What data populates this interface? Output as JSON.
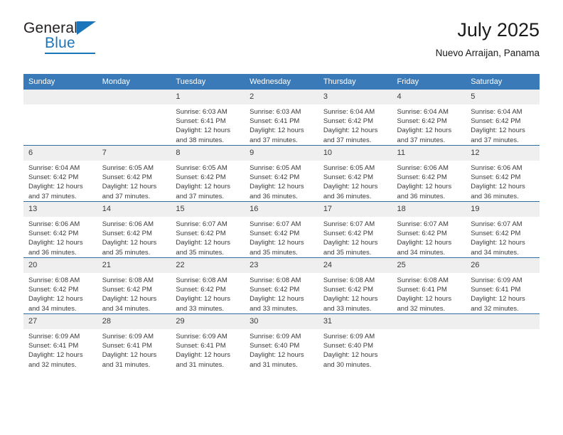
{
  "brand": {
    "name_top": "General",
    "name_bottom": "Blue",
    "accent_color": "#1b75bb"
  },
  "header": {
    "title": "July 2025",
    "subtitle": "Nuevo Arraijan, Panama",
    "header_bg": "#3a7ab8",
    "daynum_bg": "#efefef",
    "row_divider": "#2e6da4"
  },
  "weekday_headers": [
    "Sunday",
    "Monday",
    "Tuesday",
    "Wednesday",
    "Thursday",
    "Friday",
    "Saturday"
  ],
  "labels": {
    "sunrise": "Sunrise:",
    "sunset": "Sunset:",
    "daylight": "Daylight:"
  },
  "weeks": [
    [
      {
        "day": "",
        "sunrise": "",
        "sunset": "",
        "daylight_a": "",
        "daylight_b": ""
      },
      {
        "day": "",
        "sunrise": "",
        "sunset": "",
        "daylight_a": "",
        "daylight_b": ""
      },
      {
        "day": "1",
        "sunrise": "Sunrise: 6:03 AM",
        "sunset": "Sunset: 6:41 PM",
        "daylight_a": "Daylight: 12 hours",
        "daylight_b": "and 38 minutes."
      },
      {
        "day": "2",
        "sunrise": "Sunrise: 6:03 AM",
        "sunset": "Sunset: 6:41 PM",
        "daylight_a": "Daylight: 12 hours",
        "daylight_b": "and 37 minutes."
      },
      {
        "day": "3",
        "sunrise": "Sunrise: 6:04 AM",
        "sunset": "Sunset: 6:42 PM",
        "daylight_a": "Daylight: 12 hours",
        "daylight_b": "and 37 minutes."
      },
      {
        "day": "4",
        "sunrise": "Sunrise: 6:04 AM",
        "sunset": "Sunset: 6:42 PM",
        "daylight_a": "Daylight: 12 hours",
        "daylight_b": "and 37 minutes."
      },
      {
        "day": "5",
        "sunrise": "Sunrise: 6:04 AM",
        "sunset": "Sunset: 6:42 PM",
        "daylight_a": "Daylight: 12 hours",
        "daylight_b": "and 37 minutes."
      }
    ],
    [
      {
        "day": "6",
        "sunrise": "Sunrise: 6:04 AM",
        "sunset": "Sunset: 6:42 PM",
        "daylight_a": "Daylight: 12 hours",
        "daylight_b": "and 37 minutes."
      },
      {
        "day": "7",
        "sunrise": "Sunrise: 6:05 AM",
        "sunset": "Sunset: 6:42 PM",
        "daylight_a": "Daylight: 12 hours",
        "daylight_b": "and 37 minutes."
      },
      {
        "day": "8",
        "sunrise": "Sunrise: 6:05 AM",
        "sunset": "Sunset: 6:42 PM",
        "daylight_a": "Daylight: 12 hours",
        "daylight_b": "and 37 minutes."
      },
      {
        "day": "9",
        "sunrise": "Sunrise: 6:05 AM",
        "sunset": "Sunset: 6:42 PM",
        "daylight_a": "Daylight: 12 hours",
        "daylight_b": "and 36 minutes."
      },
      {
        "day": "10",
        "sunrise": "Sunrise: 6:05 AM",
        "sunset": "Sunset: 6:42 PM",
        "daylight_a": "Daylight: 12 hours",
        "daylight_b": "and 36 minutes."
      },
      {
        "day": "11",
        "sunrise": "Sunrise: 6:06 AM",
        "sunset": "Sunset: 6:42 PM",
        "daylight_a": "Daylight: 12 hours",
        "daylight_b": "and 36 minutes."
      },
      {
        "day": "12",
        "sunrise": "Sunrise: 6:06 AM",
        "sunset": "Sunset: 6:42 PM",
        "daylight_a": "Daylight: 12 hours",
        "daylight_b": "and 36 minutes."
      }
    ],
    [
      {
        "day": "13",
        "sunrise": "Sunrise: 6:06 AM",
        "sunset": "Sunset: 6:42 PM",
        "daylight_a": "Daylight: 12 hours",
        "daylight_b": "and 36 minutes."
      },
      {
        "day": "14",
        "sunrise": "Sunrise: 6:06 AM",
        "sunset": "Sunset: 6:42 PM",
        "daylight_a": "Daylight: 12 hours",
        "daylight_b": "and 35 minutes."
      },
      {
        "day": "15",
        "sunrise": "Sunrise: 6:07 AM",
        "sunset": "Sunset: 6:42 PM",
        "daylight_a": "Daylight: 12 hours",
        "daylight_b": "and 35 minutes."
      },
      {
        "day": "16",
        "sunrise": "Sunrise: 6:07 AM",
        "sunset": "Sunset: 6:42 PM",
        "daylight_a": "Daylight: 12 hours",
        "daylight_b": "and 35 minutes."
      },
      {
        "day": "17",
        "sunrise": "Sunrise: 6:07 AM",
        "sunset": "Sunset: 6:42 PM",
        "daylight_a": "Daylight: 12 hours",
        "daylight_b": "and 35 minutes."
      },
      {
        "day": "18",
        "sunrise": "Sunrise: 6:07 AM",
        "sunset": "Sunset: 6:42 PM",
        "daylight_a": "Daylight: 12 hours",
        "daylight_b": "and 34 minutes."
      },
      {
        "day": "19",
        "sunrise": "Sunrise: 6:07 AM",
        "sunset": "Sunset: 6:42 PM",
        "daylight_a": "Daylight: 12 hours",
        "daylight_b": "and 34 minutes."
      }
    ],
    [
      {
        "day": "20",
        "sunrise": "Sunrise: 6:08 AM",
        "sunset": "Sunset: 6:42 PM",
        "daylight_a": "Daylight: 12 hours",
        "daylight_b": "and 34 minutes."
      },
      {
        "day": "21",
        "sunrise": "Sunrise: 6:08 AM",
        "sunset": "Sunset: 6:42 PM",
        "daylight_a": "Daylight: 12 hours",
        "daylight_b": "and 34 minutes."
      },
      {
        "day": "22",
        "sunrise": "Sunrise: 6:08 AM",
        "sunset": "Sunset: 6:42 PM",
        "daylight_a": "Daylight: 12 hours",
        "daylight_b": "and 33 minutes."
      },
      {
        "day": "23",
        "sunrise": "Sunrise: 6:08 AM",
        "sunset": "Sunset: 6:42 PM",
        "daylight_a": "Daylight: 12 hours",
        "daylight_b": "and 33 minutes."
      },
      {
        "day": "24",
        "sunrise": "Sunrise: 6:08 AM",
        "sunset": "Sunset: 6:42 PM",
        "daylight_a": "Daylight: 12 hours",
        "daylight_b": "and 33 minutes."
      },
      {
        "day": "25",
        "sunrise": "Sunrise: 6:08 AM",
        "sunset": "Sunset: 6:41 PM",
        "daylight_a": "Daylight: 12 hours",
        "daylight_b": "and 32 minutes."
      },
      {
        "day": "26",
        "sunrise": "Sunrise: 6:09 AM",
        "sunset": "Sunset: 6:41 PM",
        "daylight_a": "Daylight: 12 hours",
        "daylight_b": "and 32 minutes."
      }
    ],
    [
      {
        "day": "27",
        "sunrise": "Sunrise: 6:09 AM",
        "sunset": "Sunset: 6:41 PM",
        "daylight_a": "Daylight: 12 hours",
        "daylight_b": "and 32 minutes."
      },
      {
        "day": "28",
        "sunrise": "Sunrise: 6:09 AM",
        "sunset": "Sunset: 6:41 PM",
        "daylight_a": "Daylight: 12 hours",
        "daylight_b": "and 31 minutes."
      },
      {
        "day": "29",
        "sunrise": "Sunrise: 6:09 AM",
        "sunset": "Sunset: 6:41 PM",
        "daylight_a": "Daylight: 12 hours",
        "daylight_b": "and 31 minutes."
      },
      {
        "day": "30",
        "sunrise": "Sunrise: 6:09 AM",
        "sunset": "Sunset: 6:40 PM",
        "daylight_a": "Daylight: 12 hours",
        "daylight_b": "and 31 minutes."
      },
      {
        "day": "31",
        "sunrise": "Sunrise: 6:09 AM",
        "sunset": "Sunset: 6:40 PM",
        "daylight_a": "Daylight: 12 hours",
        "daylight_b": "and 30 minutes."
      },
      {
        "day": "",
        "sunrise": "",
        "sunset": "",
        "daylight_a": "",
        "daylight_b": ""
      },
      {
        "day": "",
        "sunrise": "",
        "sunset": "",
        "daylight_a": "",
        "daylight_b": ""
      }
    ]
  ]
}
